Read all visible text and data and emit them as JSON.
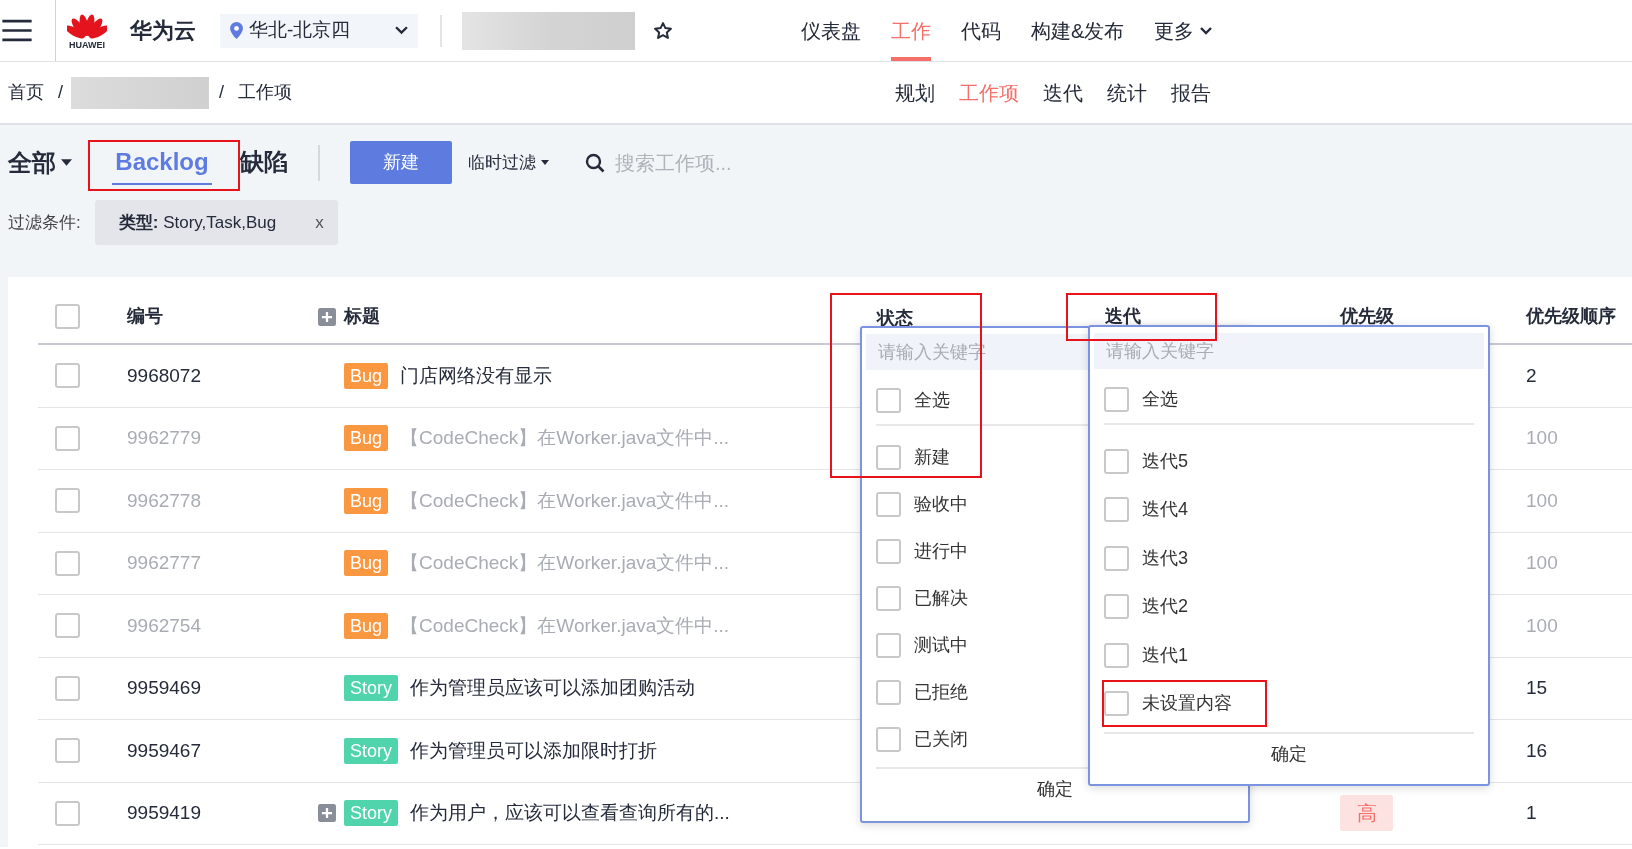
{
  "top_nav": {
    "logo_text": "HUAWEI",
    "brand": "华为云",
    "region": "华北-北京四",
    "tabs": [
      {
        "label": "仪表盘",
        "selected": false
      },
      {
        "label": "工作",
        "selected": true
      },
      {
        "label": "代码",
        "selected": false
      },
      {
        "label": "构建&发布",
        "selected": false
      },
      {
        "label": "更多",
        "selected": false,
        "kind": "menu"
      }
    ]
  },
  "breadcrumb": {
    "items": [
      "首页",
      "工作项"
    ],
    "separators": [
      "/",
      "/"
    ]
  },
  "sub_tabs": [
    {
      "label": "规划",
      "selected": false
    },
    {
      "label": "工作项",
      "selected": true
    },
    {
      "label": "迭代",
      "selected": false
    },
    {
      "label": "统计",
      "selected": false
    },
    {
      "label": "报告",
      "selected": false
    }
  ],
  "toolbar": {
    "scope": "全部",
    "view_tabs": [
      {
        "label": "Backlog",
        "selected": true
      },
      {
        "label": "缺陷",
        "selected": false
      }
    ],
    "new_button": "新建",
    "quick_filter": "临时过滤",
    "search_placeholder": "搜索工作项..."
  },
  "filter": {
    "label": "过滤条件:",
    "chip_key": "类型:",
    "chip_value": "Story,Task,Bug",
    "chip_remove": "x"
  },
  "table": {
    "select_all_checked": false,
    "columns": [
      "编号",
      "标题",
      "状态",
      "迭代",
      "优先级",
      "优先级顺序"
    ],
    "rows": [
      {
        "checked": false,
        "id": "9968072",
        "kind": "bug",
        "type": "Bug",
        "title": "门店网络没有显示",
        "dimmed": false,
        "expandable": false,
        "order": "2"
      },
      {
        "checked": false,
        "id": "9962779",
        "kind": "bug",
        "type": "Bug",
        "title": "【CodeCheck】在Worker.java文件中...",
        "dimmed": true,
        "expandable": false,
        "order": "100"
      },
      {
        "checked": false,
        "id": "9962778",
        "kind": "bug",
        "type": "Bug",
        "title": "【CodeCheck】在Worker.java文件中...",
        "dimmed": true,
        "expandable": false,
        "order": "100"
      },
      {
        "checked": false,
        "id": "9962777",
        "kind": "bug",
        "type": "Bug",
        "title": "【CodeCheck】在Worker.java文件中...",
        "dimmed": true,
        "expandable": false,
        "order": "100"
      },
      {
        "checked": false,
        "id": "9962754",
        "kind": "bug",
        "type": "Bug",
        "title": "【CodeCheck】在Worker.java文件中...",
        "dimmed": true,
        "expandable": false,
        "order": "100"
      },
      {
        "checked": false,
        "id": "9959469",
        "kind": "story",
        "type": "Story",
        "title": "作为管理员应该可以添加团购活动",
        "dimmed": false,
        "expandable": false,
        "order": "15"
      },
      {
        "checked": false,
        "id": "9959467",
        "kind": "story",
        "type": "Story",
        "title": "作为管理员可以添加限时打折",
        "dimmed": false,
        "expandable": false,
        "order": "16"
      },
      {
        "checked": false,
        "id": "9959419",
        "kind": "story",
        "type": "Story",
        "title": "作为用户，应该可以查看查询所有的...",
        "dimmed": false,
        "expandable": true,
        "priority": "高",
        "order": "1"
      }
    ]
  },
  "status_dropdown": {
    "placeholder": "请输入关键字",
    "select_all": {
      "label": "全选",
      "checked": false
    },
    "options": [
      {
        "label": "新建",
        "checked": false
      },
      {
        "label": "验收中",
        "checked": false
      },
      {
        "label": "进行中",
        "checked": false
      },
      {
        "label": "已解决",
        "checked": false
      },
      {
        "label": "测试中",
        "checked": false
      },
      {
        "label": "已拒绝",
        "checked": false
      },
      {
        "label": "已关闭",
        "checked": false
      }
    ],
    "confirm": "确定"
  },
  "iteration_dropdown": {
    "placeholder": "请输入关键字",
    "select_all": {
      "label": "全选",
      "checked": false
    },
    "options": [
      {
        "label": "迭代5",
        "checked": false
      },
      {
        "label": "迭代4",
        "checked": false
      },
      {
        "label": "迭代3",
        "checked": false
      },
      {
        "label": "迭代2",
        "checked": false
      },
      {
        "label": "迭代1",
        "checked": false
      },
      {
        "label": "未设置内容",
        "checked": false
      }
    ],
    "confirm": "确定"
  }
}
